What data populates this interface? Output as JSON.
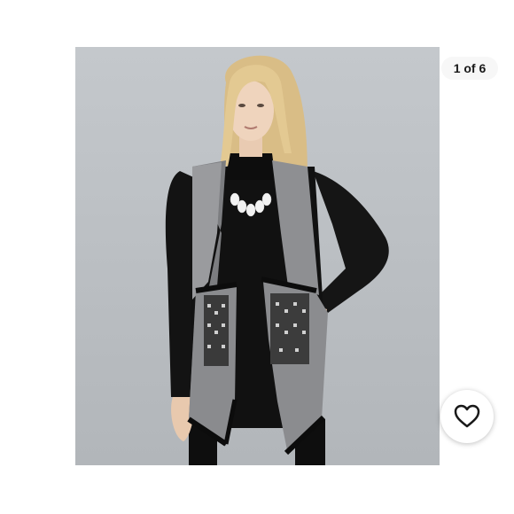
{
  "gallery": {
    "image_counter": "1 of 6",
    "favorite_icon": "heart-icon",
    "colors": {
      "page_background": "#ffffff",
      "photo_background": "#c0c4c8",
      "badge_background": "#f7f7f7",
      "text": "#191919"
    }
  }
}
